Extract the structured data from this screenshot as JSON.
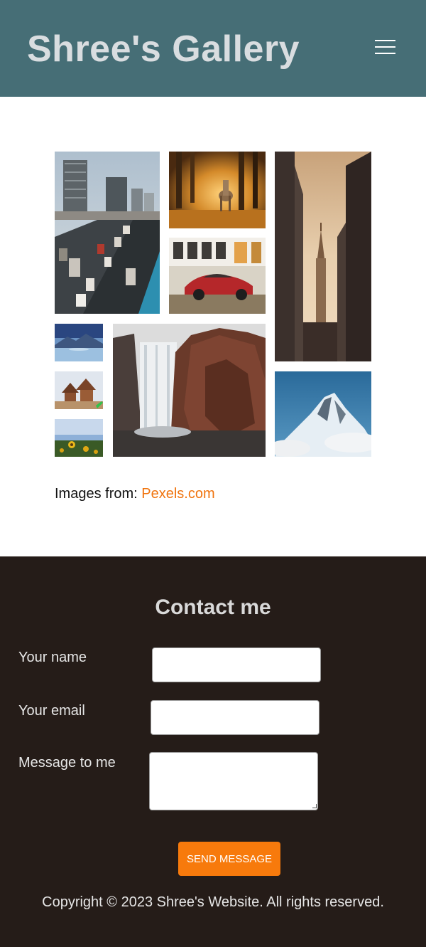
{
  "header": {
    "title": "Shree's Gallery",
    "menu_icon": "hamburger-menu-icon",
    "background_color": "#466e76"
  },
  "gallery": {
    "images": [
      {
        "id": "city-traffic",
        "subject": "city highway traffic"
      },
      {
        "id": "horse-forest",
        "subject": "horse in sunlit forest"
      },
      {
        "id": "red-car",
        "subject": "red sports car"
      },
      {
        "id": "city-tower",
        "subject": "tower between buildings at sunset"
      },
      {
        "id": "lake-mountains",
        "subject": "mountain lake"
      },
      {
        "id": "temple",
        "subject": "temple square"
      },
      {
        "id": "sunflowers",
        "subject": "sunflower field"
      },
      {
        "id": "waterfall",
        "subject": "waterfall cliff"
      },
      {
        "id": "snow-peak",
        "subject": "snowy mountain peak"
      }
    ]
  },
  "credit": {
    "prefix": "Images from:",
    "link_text": "Pexels.com",
    "link_color": "#f0740e"
  },
  "footer": {
    "title": "Contact me",
    "name_label": "Your name",
    "email_label": "Your email",
    "message_label": "Message to me",
    "name_value": "",
    "email_value": "",
    "message_value": "",
    "submit_label": "SEND MESSAGE",
    "submit_color": "#f77a0c",
    "copyright": "Copyright © 2023 Shree's Website. All rights reserved.",
    "background_color": "#251c18"
  }
}
